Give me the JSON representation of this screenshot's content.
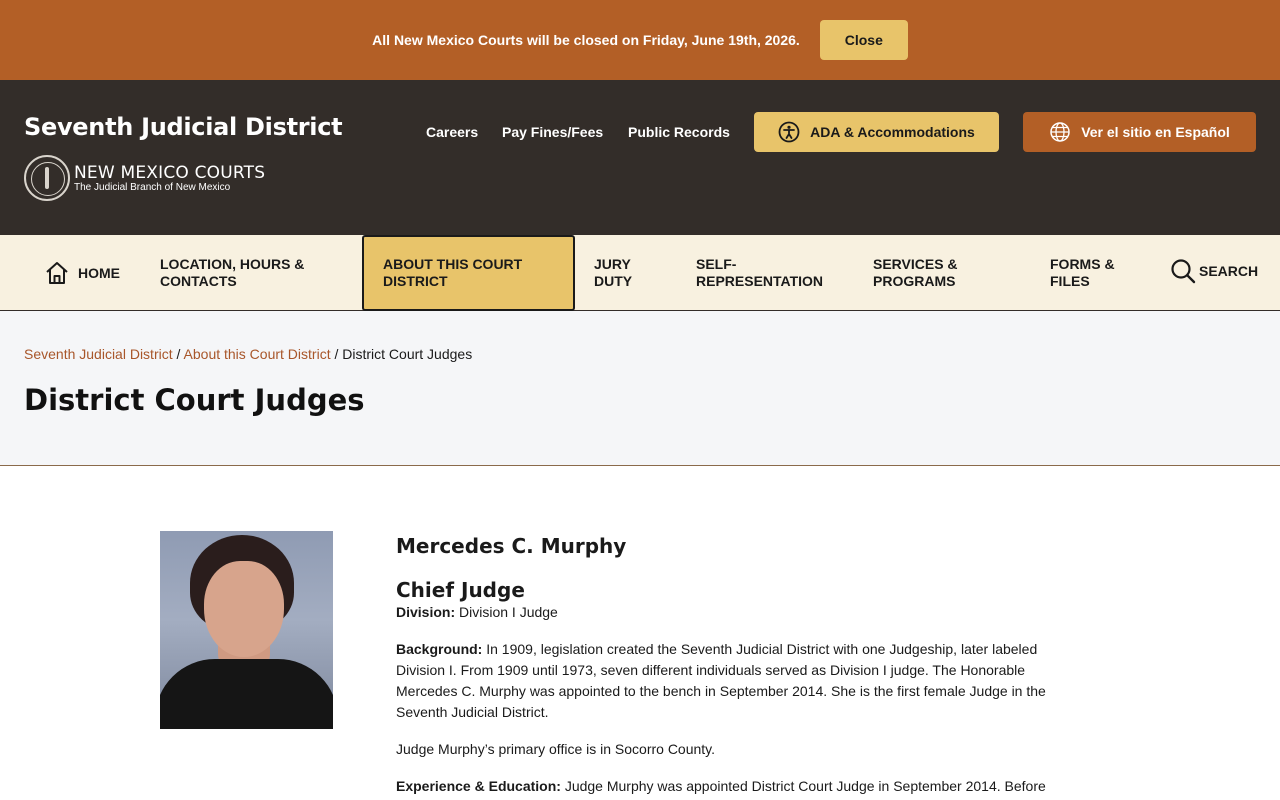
{
  "alert": {
    "text": "All New Mexico Courts will be closed on Friday, June 19th, 2026.",
    "close_label": "Close"
  },
  "header": {
    "site_title": "Seventh Judicial District",
    "logo_main": "NEW MEXICO COURTS",
    "logo_sub": "The Judicial Branch of New Mexico",
    "links": [
      "Careers",
      "Pay Fines/Fees",
      "Public Records"
    ],
    "ada_label": "ADA & Accommodations",
    "spanish_label": "Ver el sitio en Español"
  },
  "nav": {
    "home": "HOME",
    "location": [
      "LOCATION, HOURS &",
      "CONTACTS"
    ],
    "about": [
      "ABOUT THIS COURT",
      "DISTRICT"
    ],
    "jury": [
      "JURY",
      "DUTY"
    ],
    "self_rep": [
      "SELF-",
      "REPRESENTATION"
    ],
    "services": [
      "SERVICES &",
      "PROGRAMS"
    ],
    "forms": [
      "FORMS &",
      "FILES"
    ],
    "search": "SEARCH"
  },
  "breadcrumb": {
    "items": [
      "Seventh Judicial District",
      "About this Court District"
    ],
    "separator": "/",
    "current": "District Court Judges"
  },
  "page_title": "District Court Judges",
  "judge": {
    "name": "Mercedes C. Murphy",
    "role": "Chief Judge",
    "division_label": "Division:",
    "division_value": "Division I Judge",
    "background_label": "Background:",
    "background_text": "In 1909, legislation created the Seventh Judicial District with one Judgeship, later labeled Division I. From 1909 until 1973, seven different individuals served as Division I judge. The Honorable Mercedes C. Murphy was appointed to the bench in September 2014. She is the first female Judge in the Seventh Judicial District.",
    "office_text": "Judge Murphy’s primary office is in Socorro County.",
    "experience_label": "Experience & Education:",
    "experience_text": "Judge Murphy was appointed District Court Judge in September 2014. Before"
  },
  "colors": {
    "brand_orange": "#b35f26",
    "header_dark": "#332d29",
    "accent_gold": "#e8c46a",
    "nav_cream": "#f8f1e0"
  }
}
